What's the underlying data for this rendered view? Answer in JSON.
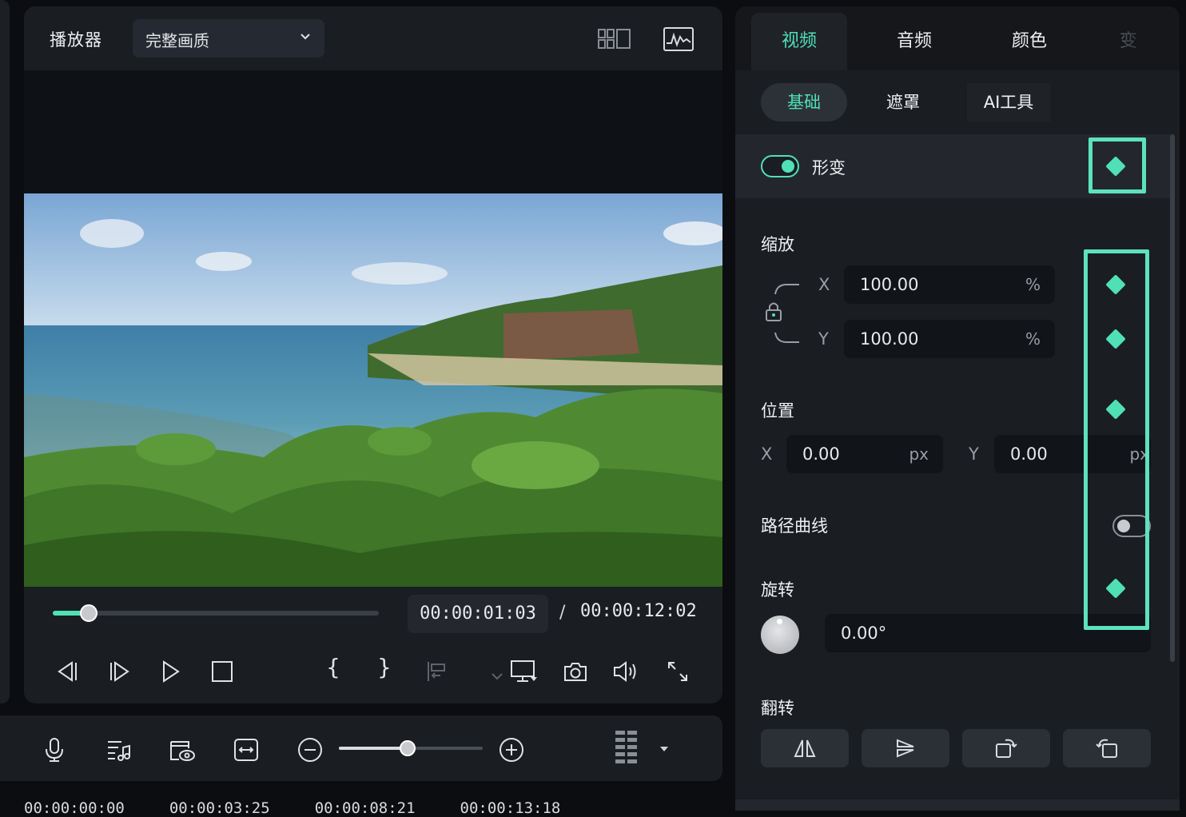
{
  "player": {
    "title": "播放器",
    "quality": "完整画质",
    "current_time": "00:00:01:03",
    "separator": "/",
    "total_time": "00:00:12:02",
    "progress": 0.11,
    "brace_open": "{",
    "brace_close": "}"
  },
  "timeline": {
    "zoom_level": 0.48,
    "ruler_marks": [
      "00:00:00:00",
      "00:00:03:25",
      "00:00:08:21",
      "00:00:13:18"
    ]
  },
  "panel": {
    "tabs": [
      "视频",
      "音频",
      "颜色",
      "变"
    ],
    "subtabs": [
      "基础",
      "遮罩",
      "AI工具"
    ],
    "transform": {
      "label": "形变",
      "enabled": true,
      "scale": {
        "label": "缩放",
        "x_axis": "X",
        "x_value": "100.00",
        "y_axis": "Y",
        "y_value": "100.00",
        "unit": "%"
      },
      "position": {
        "label": "位置",
        "x_axis": "X",
        "x_value": "0.00",
        "y_axis": "Y",
        "y_value": "0.00",
        "unit": "px"
      },
      "path_curve": {
        "label": "路径曲线",
        "enabled": false
      },
      "rotation": {
        "label": "旋转",
        "value": "0.00°"
      },
      "flip": {
        "label": "翻转"
      }
    }
  },
  "colors": {
    "accent": "#4fe0b6",
    "highlight": "#5de2bd"
  }
}
